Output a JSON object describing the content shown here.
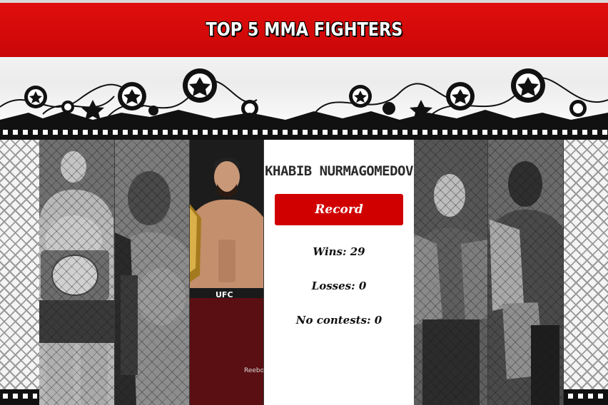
{
  "header": {
    "title": "TOP 5 MMA FIGHTERS"
  },
  "fighters": [
    {
      "id": "fighter-1",
      "style": "grayscale"
    },
    {
      "id": "fighter-2",
      "style": "grayscale"
    },
    {
      "id": "fighter-3",
      "style": "color",
      "trunks_text": "UFC",
      "sponsor_text": "Reebok"
    },
    {
      "id": "fighter-4",
      "style": "grayscale"
    },
    {
      "id": "fighter-5",
      "style": "grayscale"
    }
  ],
  "panel": {
    "name": "KHABIB NURMAGOMEDOV",
    "record_label": "Record",
    "wins": "Wins: 29",
    "losses": "Losses: 0",
    "no_contests": "No contests: 0"
  },
  "colors": {
    "header_red": "#d00000",
    "button_red": "#d00000"
  }
}
